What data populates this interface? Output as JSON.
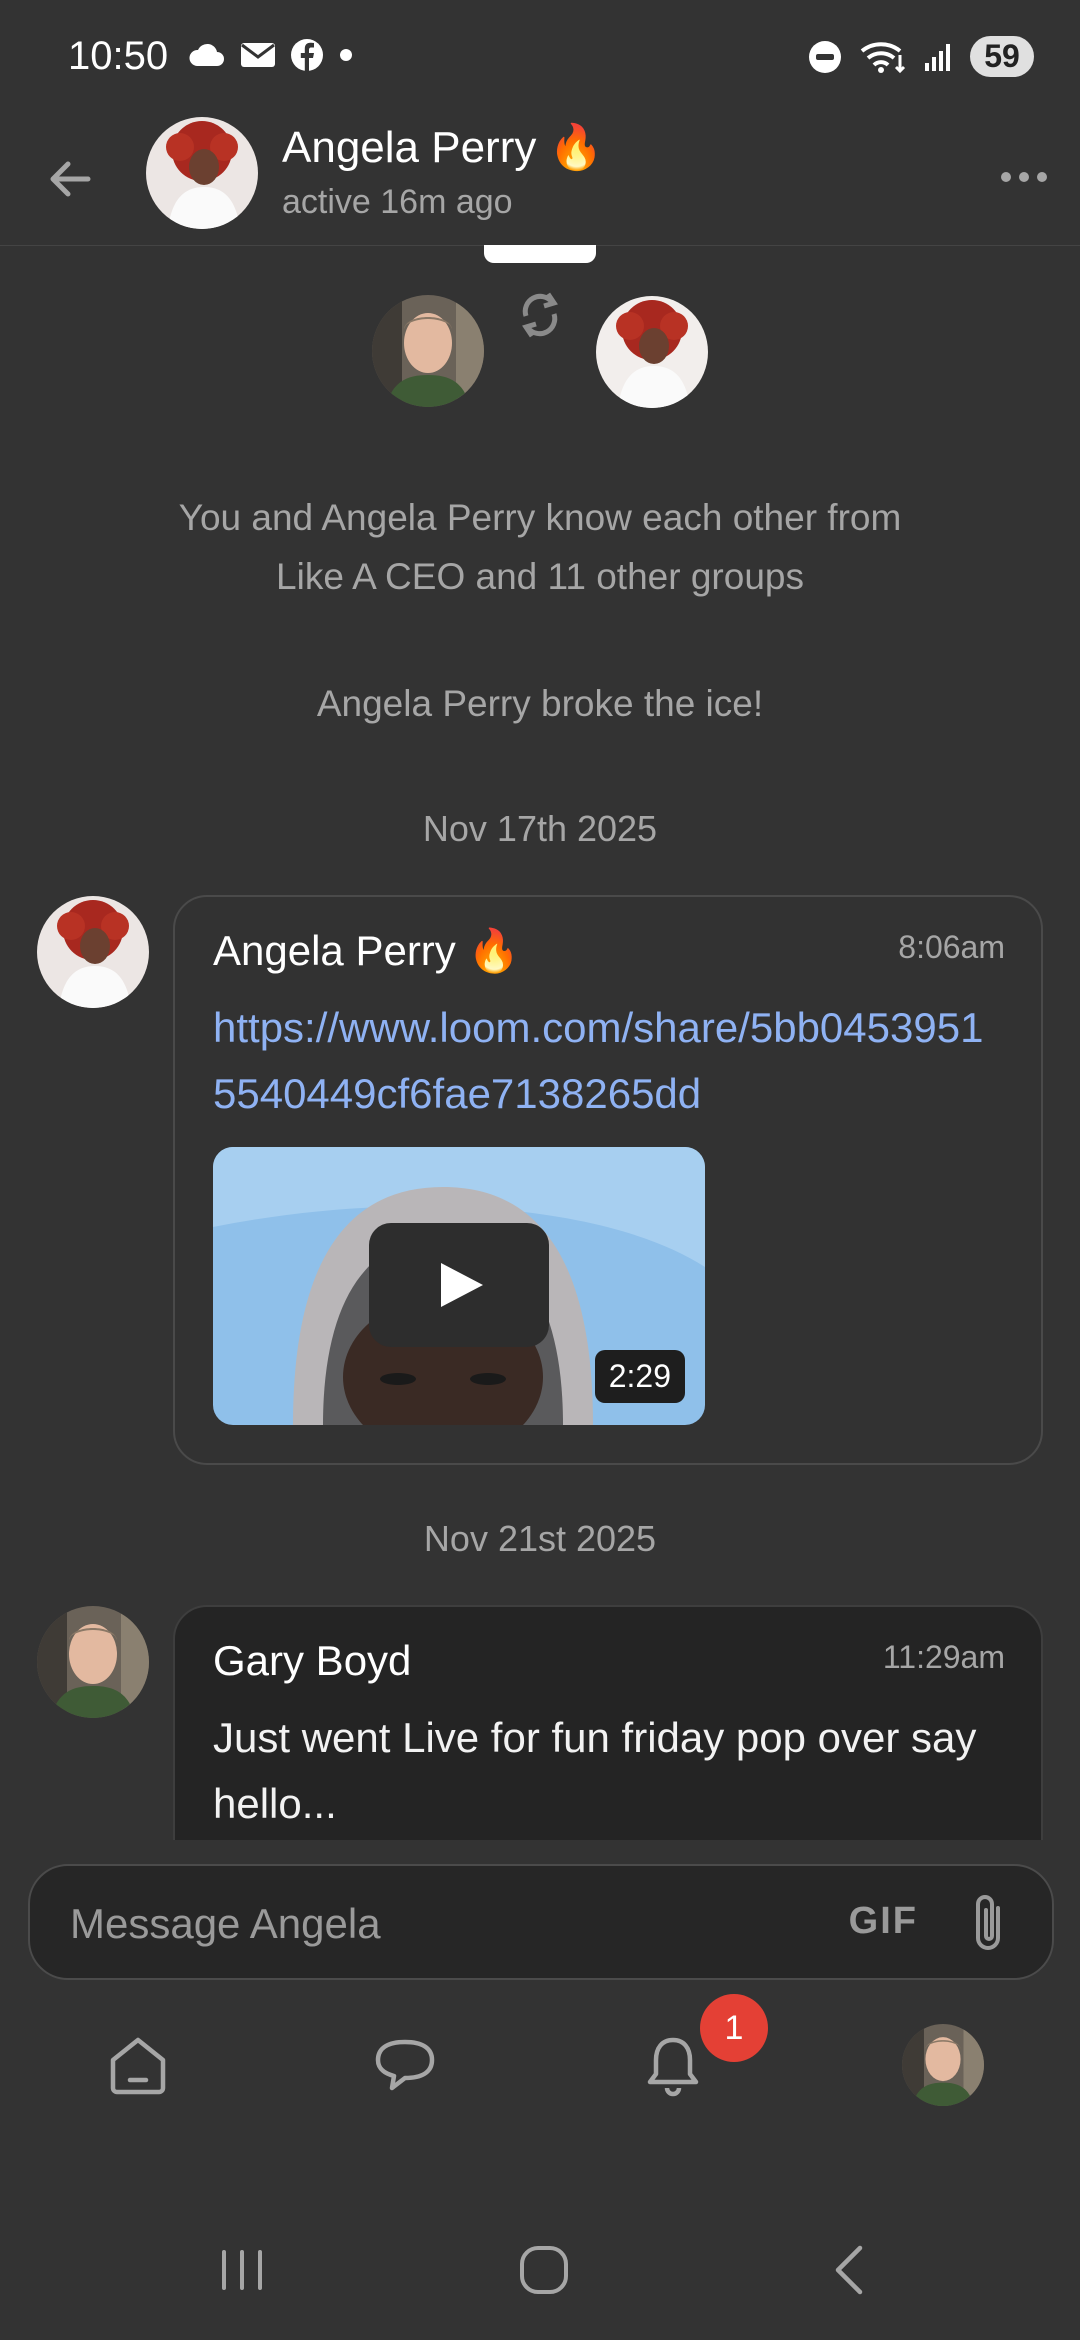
{
  "status_bar": {
    "time": "10:50",
    "battery": "59",
    "icons": [
      "cloud-icon",
      "mail-icon",
      "facebook-icon",
      "dot-icon",
      "dnd-icon",
      "wifi-icon",
      "signal-icon"
    ]
  },
  "header": {
    "name": "Angela Perry",
    "emoji": "🔥",
    "status": "active 16m ago"
  },
  "intro": {
    "line1": "You and Angela Perry know each other from",
    "line2": "Like A CEO and 11 other groups",
    "ice": "Angela Perry broke the ice!"
  },
  "messages": [
    {
      "date": "Nov 17th 2025",
      "author": "Angela Perry",
      "emoji": "🔥",
      "time": "8:06am",
      "link": "https://www.loom.com/share/5bb04539515540449cf6fae7138265dd",
      "video_duration": "2:29"
    },
    {
      "date": "Nov 21st 2025",
      "author": "Gary Boyd",
      "time": "11:29am",
      "text": "Just went Live for fun friday pop over say hello..."
    }
  ],
  "composer": {
    "placeholder": "Message Angela",
    "gif_label": "GIF"
  },
  "nav": {
    "notification_count": "1"
  },
  "colors": {
    "background": "#333333",
    "link": "#8fb2f3",
    "badge": "#e44035"
  }
}
